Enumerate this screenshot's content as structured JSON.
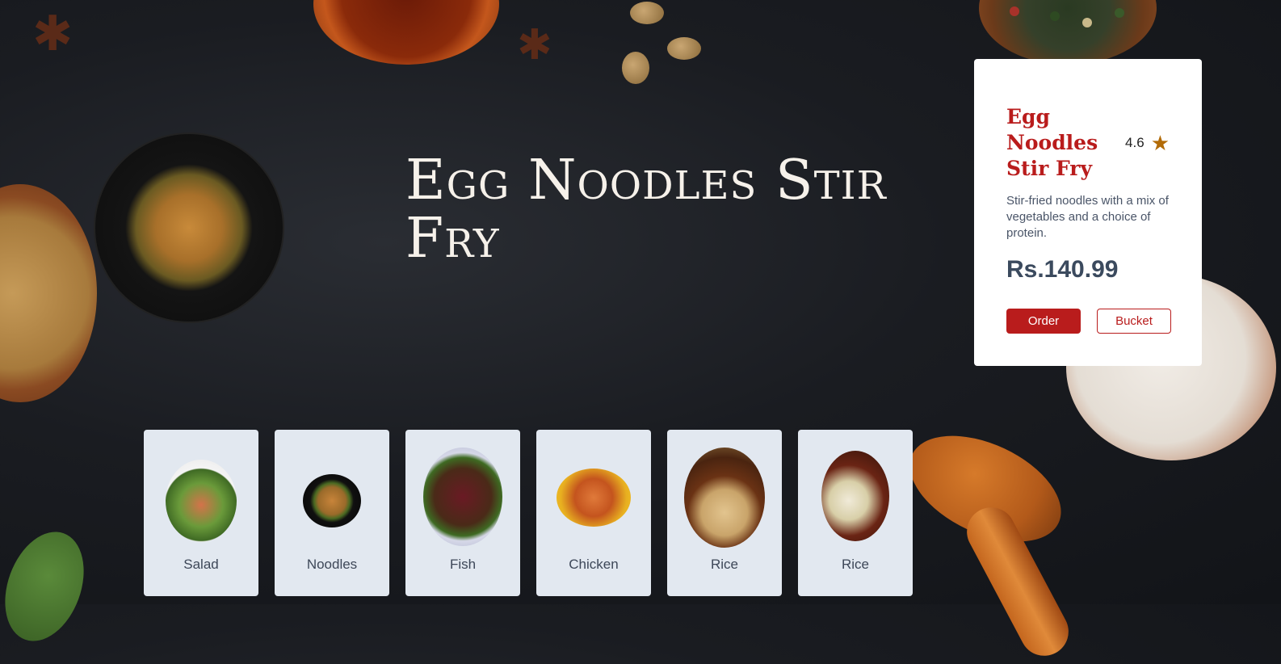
{
  "hero": {
    "title": "Egg Noodles Stir Fry"
  },
  "detail_card": {
    "title": "Egg Noodles Stir Fry",
    "rating": "4.6",
    "rating_icon": "star-icon",
    "description": "Stir-fried noodles with a mix of vegetables and a choice of protein.",
    "price": "Rs.140.99",
    "order_label": "Order",
    "bucket_label": "Bucket",
    "accent_color": "#b91c1c"
  },
  "categories": [
    {
      "label": "Salad"
    },
    {
      "label": "Noodles"
    },
    {
      "label": "Fish"
    },
    {
      "label": "Chicken"
    },
    {
      "label": "Rice"
    },
    {
      "label": "Rice"
    }
  ]
}
